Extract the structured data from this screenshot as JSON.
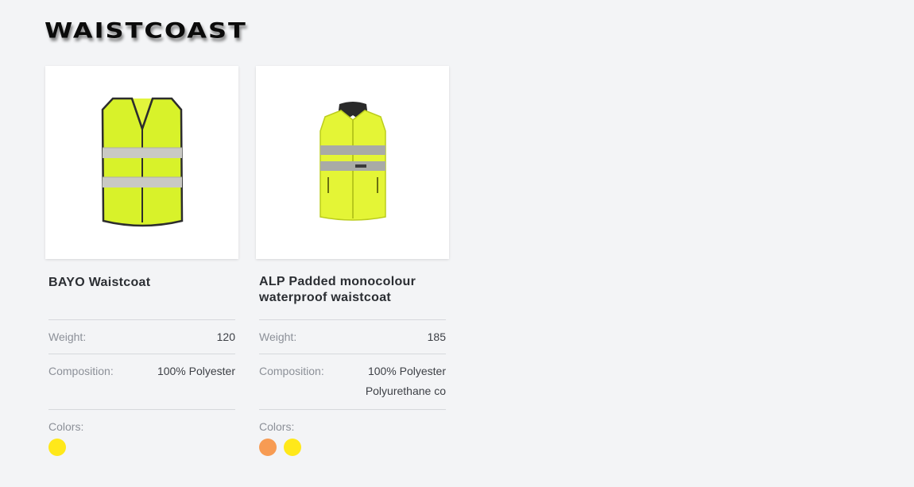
{
  "page": {
    "title": "WAISTCOAST"
  },
  "products": [
    {
      "name": "BAYO Waistcoat",
      "weight_label": "Weight:",
      "weight": "120",
      "composition_label": "Composition:",
      "composition": [
        "100% Polyester"
      ],
      "colors_label": "Colors:",
      "colors": [
        "#ffe81a"
      ],
      "image_icon": "hi-vis-vest-icon"
    },
    {
      "name": "ALP Padded monocolour waterproof waistcoat",
      "weight_label": "Weight:",
      "weight": "185",
      "composition_label": "Composition:",
      "composition": [
        "100% Polyester",
        "Polyurethane co"
      ],
      "colors_label": "Colors:",
      "colors": [
        "#f79b53",
        "#ffe81a"
      ],
      "image_icon": "padded-hi-vis-vest-icon"
    }
  ]
}
